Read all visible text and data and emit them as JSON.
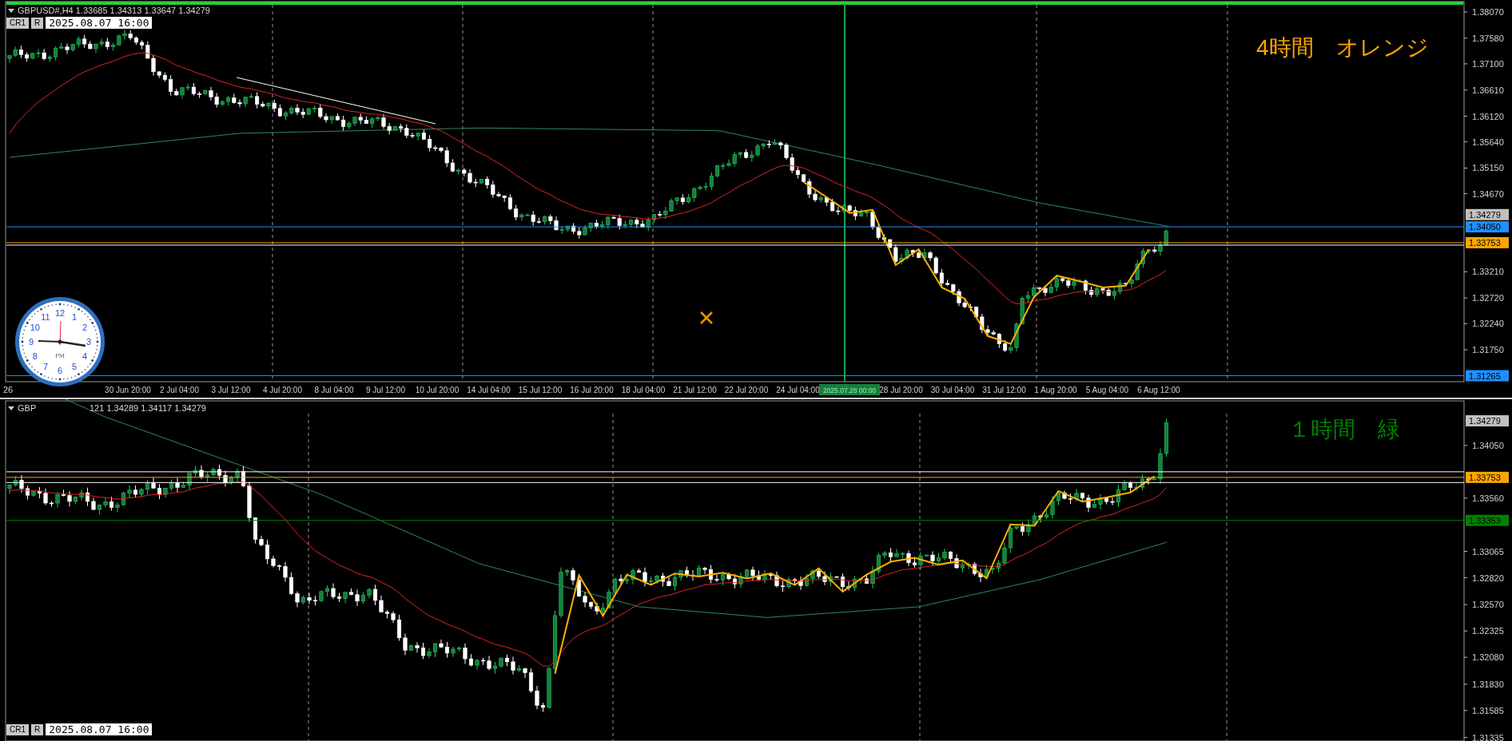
{
  "top_chart": {
    "header": "GBPUSD#,H4 1.33685 1.34313 1.33647 1.34279",
    "toolbar": {
      "buttons": [
        "CR1",
        "R"
      ],
      "date_field": "2025.08.07 16:00"
    },
    "overlay_label": "4時間　オレンジ",
    "price_labels": [
      "1.38070",
      "1.37580",
      "1.37100",
      "1.36610",
      "1.36120",
      "1.35640",
      "1.35150",
      "1.34670",
      "1.33210",
      "1.32720",
      "1.32240",
      "1.31750"
    ],
    "price_tags": [
      {
        "text": "1.34279",
        "color": "#c0c0c0"
      },
      {
        "text": "1.34050",
        "color": "#1e90ff"
      },
      {
        "text": "1.33753",
        "color": "#ffa500"
      },
      {
        "text": "1.31265",
        "color": "#1e90ff"
      }
    ],
    "partial_time_label": "26",
    "time_labels": [
      {
        "text": "30 Jun 20:00",
        "highlighted": false
      },
      {
        "text": "2 Jul 04:00",
        "highlighted": false
      },
      {
        "text": "3 Jul 12:00",
        "highlighted": false
      },
      {
        "text": "4 Jul 20:00",
        "highlighted": false
      },
      {
        "text": "8 Jul 04:00",
        "highlighted": false
      },
      {
        "text": "9 Jul 12:00",
        "highlighted": false
      },
      {
        "text": "10 Jul 20:00",
        "highlighted": false
      },
      {
        "text": "14 Jul 04:00",
        "highlighted": false
      },
      {
        "text": "15 Jul 12:00",
        "highlighted": false
      },
      {
        "text": "16 Jul 20:00",
        "highlighted": false
      },
      {
        "text": "18 Jul 04:00",
        "highlighted": false
      },
      {
        "text": "21 Jul 12:00",
        "highlighted": false
      },
      {
        "text": "22 Jul 20:00",
        "highlighted": false
      },
      {
        "text": "24 Jul 04:00",
        "highlighted": false
      },
      {
        "text": "2025.07.28 00:00",
        "highlighted": true
      },
      {
        "text": "28 Jul 20:00",
        "highlighted": false
      },
      {
        "text": "30 Jul 04:00",
        "highlighted": false
      },
      {
        "text": "31 Jul 12:00",
        "highlighted": false
      },
      {
        "text": "1 Aug 20:00",
        "highlighted": false
      },
      {
        "text": "5 Aug 04:00",
        "highlighted": false
      },
      {
        "text": "6 Aug 12:00",
        "highlighted": false
      }
    ]
  },
  "bottom_chart": {
    "header_parts": [
      "GBP",
      "121 1.34289 1.34117 1.34279"
    ],
    "overlay_label": "１時間　緑",
    "price_labels": [
      "1.34050",
      "1.33560",
      "1.33065",
      "1.32820",
      "1.32570",
      "1.32325",
      "1.32080",
      "1.31830",
      "1.31585",
      "1.31335"
    ],
    "price_tags": [
      {
        "text": "1.34279",
        "color": "#c0c0c0"
      },
      {
        "text": "1.33753",
        "color": "#ffa500"
      },
      {
        "text": "1.33353",
        "color": "#008000"
      }
    ],
    "toolbar": {
      "buttons": [
        "CR1",
        "R"
      ],
      "date_field": "2025.08.07 16:00"
    }
  },
  "clock": {
    "numerals": [
      "12",
      "11",
      "1",
      "10",
      "2",
      "9",
      "3",
      "8",
      "4",
      "7",
      "5",
      "6"
    ],
    "period": "PM"
  }
}
